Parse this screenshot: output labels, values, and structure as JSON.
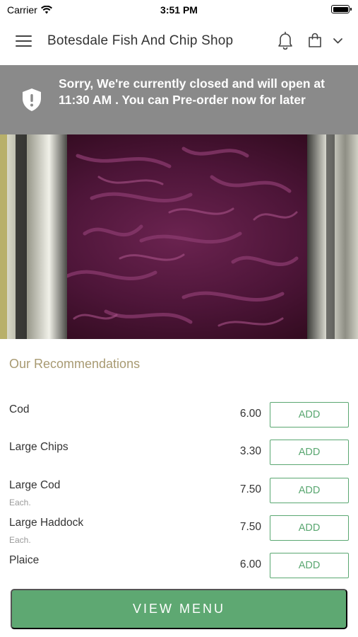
{
  "status_bar": {
    "carrier": "Carrier",
    "time": "3:51 PM"
  },
  "header": {
    "title": "Botesdale Fish And Chip Shop",
    "icons": [
      "menu-icon",
      "bell-icon",
      "bag-icon",
      "chevron-down-icon"
    ]
  },
  "notice": {
    "message": "Sorry, We're currently closed and will open at 11:30 AM . You can Pre-order now for later",
    "icon": "shield-icon",
    "background": "#8a8a8a"
  },
  "recommendations": {
    "title": "Our Recommendations",
    "items": [
      {
        "name": "Cod",
        "note": "",
        "price": "6.00",
        "action": "ADD"
      },
      {
        "name": "Large Chips",
        "note": "",
        "price": "3.30",
        "action": "ADD"
      },
      {
        "name": "Large Cod",
        "note": "Each.",
        "price": "7.50",
        "action": "ADD"
      },
      {
        "name": "Large Haddock",
        "note": "Each.",
        "price": "7.50",
        "action": "ADD"
      },
      {
        "name": "Plaice",
        "note": "",
        "price": "6.00",
        "action": "ADD"
      }
    ]
  },
  "cta": {
    "label": "VIEW MENU"
  },
  "colors": {
    "accent_green": "#5ea872",
    "section_title": "#a89a72",
    "banner_grey": "#8a8a8a"
  }
}
